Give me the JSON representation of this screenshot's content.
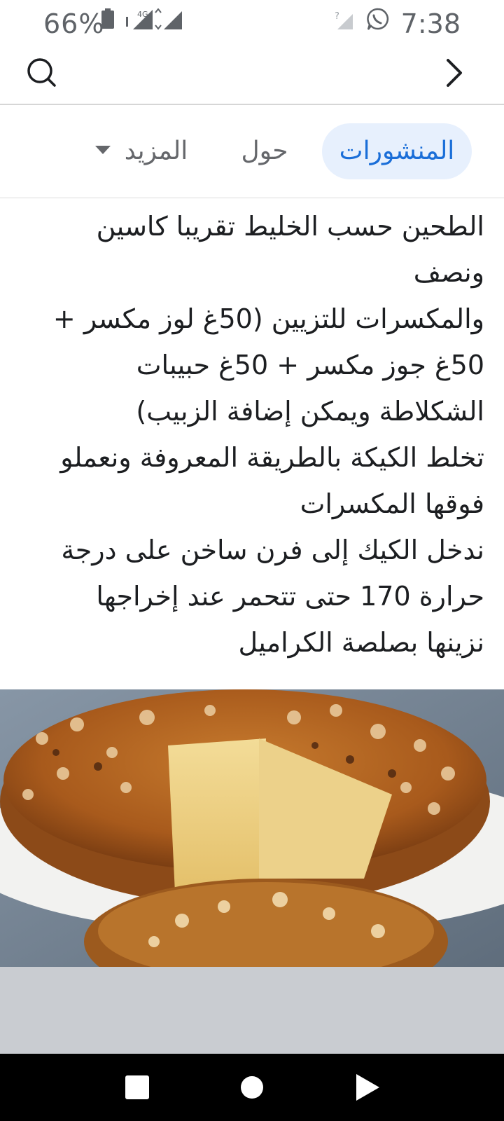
{
  "status_bar": {
    "battery_percent": "66%",
    "network_label": "4G",
    "time": "7:38",
    "icons": [
      "battery-icon",
      "signal-4g-icon",
      "no-signal-icon",
      "whatsapp-icon"
    ]
  },
  "top_bar": {
    "search_icon": "search-icon",
    "forward_icon": "chevron-right-icon"
  },
  "tabs": [
    {
      "label": "المنشورات",
      "active": true
    },
    {
      "label": "حول",
      "active": false
    },
    {
      "label": "المزيد",
      "active": false
    }
  ],
  "post": {
    "lines": [
      "الطحين حسب الخليط تقريبا كاسين",
      "ونصف",
      "والمكسرات للتزيين (50غ لوز مكسر +",
      "50غ جوز مكسر + 50غ حبيبات",
      "الشكلاطة ويمكن إضافة الزبيب)",
      "تخلط الكيكة بالطريقة المعروفة ونعملو",
      "فوقها المكسرات",
      "ندخل الكيك إلى فرن ساخن على درجة",
      "حرارة 170 حتى تتحمر عند إخراجها",
      "نزينها بصلصة الكراميل"
    ]
  },
  "colors": {
    "active_tab_bg": "#e7f0fd",
    "active_tab_text": "#1a6ed8",
    "inactive_tab_text": "#65676b",
    "status_text": "#5f6368"
  },
  "nav_bar": {
    "buttons": [
      "recents-square-icon",
      "home-circle-icon",
      "back-triangle-icon"
    ]
  }
}
